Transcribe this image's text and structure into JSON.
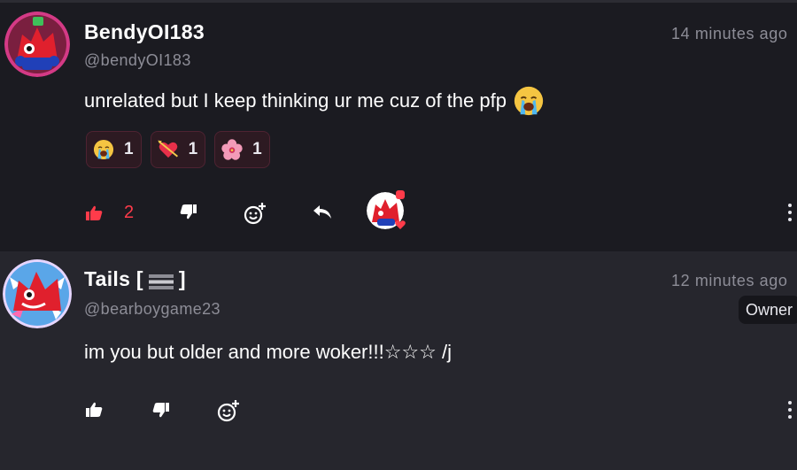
{
  "comments": [
    {
      "username": "BendyOI183",
      "handle": "@bendyOI183",
      "time": "14 minutes ago",
      "text": "unrelated but I keep thinking ur me cuz of the pfp",
      "text_emoji": "loudly-crying-face",
      "reactions": [
        {
          "emoji": "loudly-crying-face",
          "count": "1"
        },
        {
          "emoji": "heart-with-arrow",
          "count": "1"
        },
        {
          "emoji": "hibiscus",
          "count": "1"
        }
      ],
      "likes": "2",
      "liked": true
    },
    {
      "username_prefix": "Tails [",
      "username_suffix": "]",
      "handle": "@bearboygame23",
      "time": "12 minutes ago",
      "badge": "Owner",
      "text": "im you but older and more woker!!!☆☆☆ /j"
    }
  ],
  "colors": {
    "background": "#1b1b21",
    "reply_background": "#26262d",
    "muted_text": "#8d8d97",
    "like_active": "#ff3b4a",
    "reaction_bg": "#2d1a22",
    "reaction_border": "#4e2332"
  },
  "icons": {
    "like": "thumbs-up-icon",
    "dislike": "thumbs-down-icon",
    "add_reaction": "add-emoji-icon",
    "reply": "reply-arrow-icon",
    "more": "kebab-menu-icon",
    "flag": "flag-icon"
  }
}
